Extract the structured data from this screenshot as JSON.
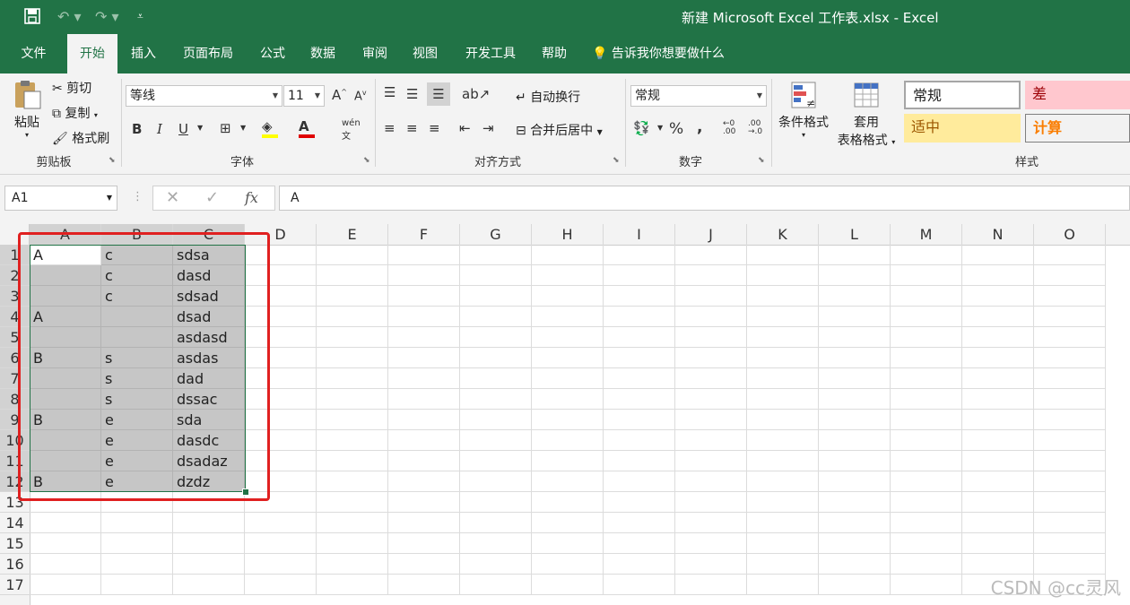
{
  "titlebar": {
    "save_icon": "save-icon",
    "undo_icon": "undo-icon",
    "redo_icon": "redo-icon",
    "title": "新建 Microsoft Excel 工作表.xlsx  -  Excel"
  },
  "tabs": [
    "文件",
    "开始",
    "插入",
    "页面布局",
    "公式",
    "数据",
    "审阅",
    "视图",
    "开发工具",
    "帮助"
  ],
  "active_tab": "开始",
  "tell_me": "告诉我你想要做什么",
  "ribbon": {
    "clipboard": {
      "paste": "粘贴",
      "cut": "剪切",
      "copy": "复制",
      "format_painter": "格式刷",
      "label": "剪贴板"
    },
    "font": {
      "name": "等线",
      "size": "11",
      "bold": "B",
      "italic": "I",
      "underline": "U",
      "label": "字体",
      "phonetic": "wén"
    },
    "alignment": {
      "wrap": "自动换行",
      "merge": "合并后居中",
      "label": "对齐方式"
    },
    "number": {
      "format": "常规",
      "percent": "%",
      "comma": ",",
      "label": "数字"
    },
    "styles": {
      "conditional": "条件格式",
      "table_format_1": "套用",
      "table_format_2": "表格格式",
      "normal": "常规",
      "bad": "差",
      "neutral": "适中",
      "calc": "计算",
      "label": "样式"
    }
  },
  "formula_bar": {
    "name_box": "A1",
    "value": "A",
    "fx": "fx"
  },
  "columns": [
    "A",
    "B",
    "C",
    "D",
    "E",
    "F",
    "G",
    "H",
    "I",
    "J",
    "K",
    "L",
    "M",
    "N",
    "O"
  ],
  "rows": [
    [
      "A",
      "c",
      "sdsa"
    ],
    [
      "",
      "c",
      "dasd"
    ],
    [
      "",
      "c",
      "sdsad"
    ],
    [
      "A",
      "",
      "dsad"
    ],
    [
      "",
      "",
      "asdasd"
    ],
    [
      "B",
      "s",
      "asdas"
    ],
    [
      "",
      "s",
      "dad"
    ],
    [
      "",
      "s",
      "dssac"
    ],
    [
      "B",
      "e",
      "sda"
    ],
    [
      "",
      "e",
      "dasdc"
    ],
    [
      "",
      "e",
      "dsadaz"
    ],
    [
      "B",
      "e",
      "dzdz"
    ],
    [
      "",
      "",
      ""
    ],
    [
      "",
      "",
      ""
    ],
    [
      "",
      "",
      ""
    ],
    [
      "",
      "",
      ""
    ],
    [
      "",
      "",
      ""
    ]
  ],
  "row_numbers": [
    "1",
    "2",
    "3",
    "4",
    "5",
    "6",
    "7",
    "8",
    "9",
    "10",
    "11",
    "12",
    "13",
    "14",
    "15",
    "16",
    "17"
  ],
  "watermark": "CSDN @cc灵风",
  "colors": {
    "excel_green": "#217346",
    "annotation_red": "#e02020",
    "selection_gray": "#c6c6c6"
  }
}
